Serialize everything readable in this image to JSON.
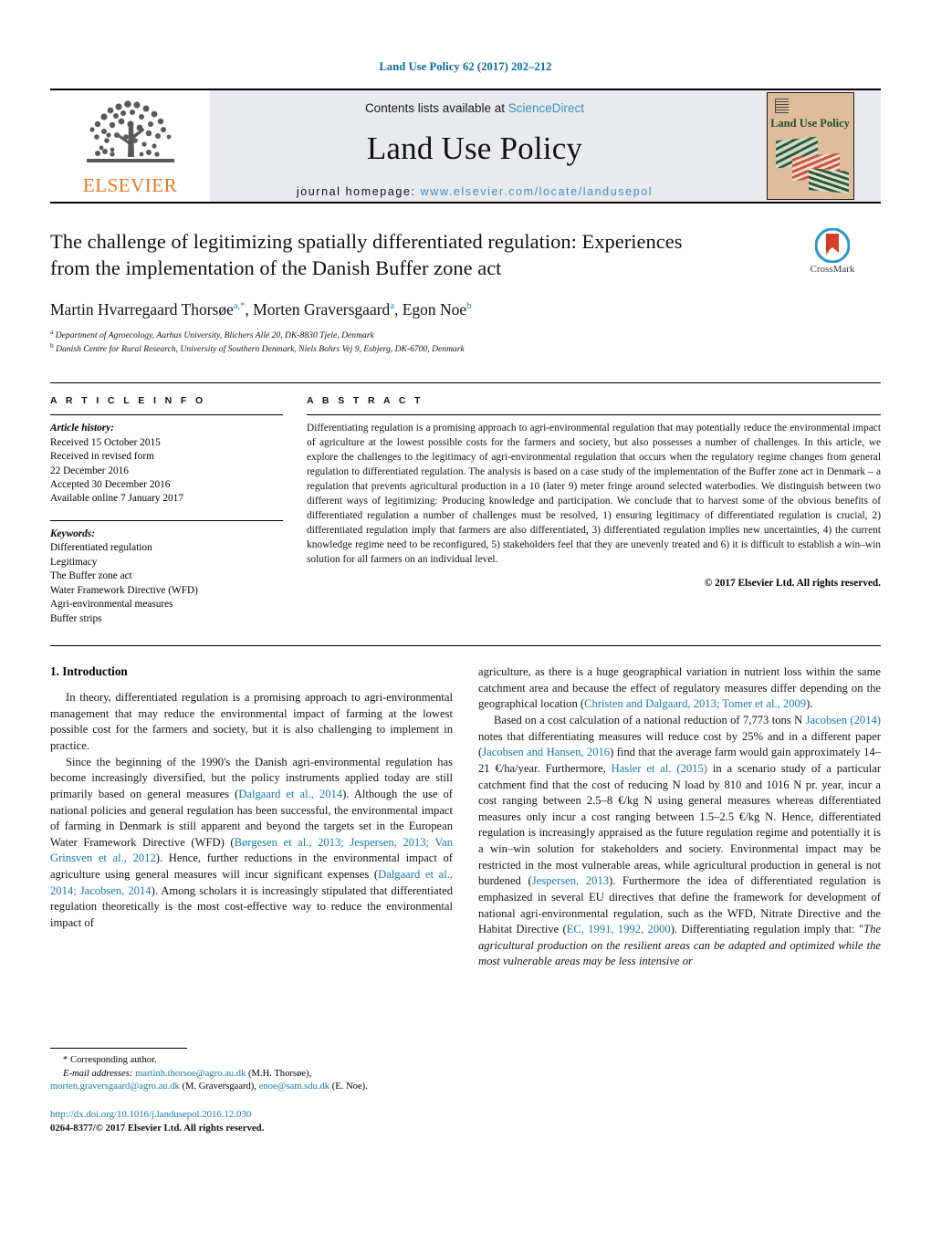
{
  "running_head": "Land Use Policy 62 (2017) 202–212",
  "masthead": {
    "contents_prefix": "Contents lists available at ",
    "sciencedirect": "ScienceDirect",
    "journal_name": "Land Use Policy",
    "homepage_prefix": "journal homepage: ",
    "homepage_url": "www.elsevier.com/locate/landusepol",
    "elsevier_wordmark": "ELSEVIER",
    "elsevier_accent_color": "#e87722",
    "link_color": "#3f8fc4",
    "cover_title": "Land Use Policy"
  },
  "title_block": {
    "title": "The challenge of legitimizing spatially differentiated regulation: Experiences from the implementation of the Danish Buffer zone act",
    "authors": [
      {
        "name": "Martin Hvarregaard Thorsøe",
        "marks": "a,*"
      },
      {
        "name": "Morten Graversgaard",
        "marks": "a"
      },
      {
        "name": "Egon Noe",
        "marks": "b"
      }
    ],
    "affiliations": [
      {
        "mark": "a",
        "text": "Department of Agroecology, Aarhus University, Blichers Allé 20, DK-8830 Tjele, Denmark"
      },
      {
        "mark": "b",
        "text": "Danish Centre for Rural Research, University of Southern Denmark, Niels Bohrs Vej 9, Esbjerg, DK-6700, Denmark"
      }
    ],
    "crossmark_label": "CrossMark"
  },
  "article_info": {
    "label": "A R T I C L E    I N F O",
    "history_head": "Article history:",
    "history_lines": [
      "Received 15 October 2015",
      "Received in revised form",
      "22 December 2016",
      "Accepted 30 December 2016",
      "Available online 7 January 2017"
    ],
    "keywords_head": "Keywords:",
    "keywords": [
      "Differentiated regulation",
      "Legitimacy",
      "The Buffer zone act",
      "Water Framework Directive (WFD)",
      "Agri-environmental measures",
      "Buffer strips"
    ]
  },
  "abstract": {
    "label": "A B S T R A C T",
    "text": "Differentiating regulation is a promising approach to agri-environmental regulation that may potentially reduce the environmental impact of agriculture at the lowest possible costs for the farmers and society, but also possesses a number of challenges. In this article, we explore the challenges to the legitimacy of agri-environmental regulation that occurs when the regulatory regime changes from general regulation to differentiated regulation. The analysis is based on a case study of the implementation of the Buffer zone act in Denmark – a regulation that prevents agricultural production in a 10 (later 9) meter fringe around selected waterbodies. We distinguish between two different ways of legitimizing: Producing knowledge and participation. We conclude that to harvest some of the obvious benefits of differentiated regulation a number of challenges must be resolved, 1) ensuring legitimacy of differentiated regulation is crucial, 2) differentiated regulation imply that farmers are also differentiated, 3) differentiated regulation implies new uncertainties, 4) the current knowledge regime need to be reconfigured, 5) stakeholders feel that they are unevenly treated and 6) it is difficult to establish a win–win solution for all farmers on an individual level.",
    "copyright": "© 2017 Elsevier Ltd. All rights reserved."
  },
  "body": {
    "section_number_title": "1.  Introduction",
    "left_column": {
      "para1_a": "In theory, differentiated regulation is a promising approach to agri-environmental management that may reduce the environmental impact of farming at the lowest possible cost for the farmers and society, but it is also challenging to implement in practice.",
      "para2_a": "Since the beginning of the 1990's the Danish agri-environmental regulation has become increasingly diversified, but the policy instruments applied today are still primarily based on general measures (",
      "cite1": "Dalgaard et al., 2014",
      "para2_b": "). Although the use of national policies and general regulation has been successful, the environmental impact of farming in Denmark is still apparent and beyond the targets set in the European Water Framework Directive (WFD) (",
      "cite2": "Børgesen et al., 2013; Jespersen, 2013; Van Grinsven et al., 2012",
      "para2_c": "). Hence, further reductions in the environmental impact of agriculture using general measures will incur significant expenses (",
      "cite3": "Dalgaard et al., 2014; Jacobsen, 2014",
      "para2_d": "). Among scholars it is increasingly stipulated that differentiated regulation theoretically is the most cost-effective way to reduce the environmental impact of"
    },
    "right_column": {
      "para_cont_a": "agriculture, as there is a huge geographical variation in nutrient loss within the same catchment area and because the effect of regulatory measures differ depending on the geographical location (",
      "cite4": "Christen and Dalgaard, 2013; Tomer et al., 2009",
      "para_cont_b": ").",
      "para3_a": "Based on a cost calculation of a national reduction of 7,773 tons N ",
      "cite5": "Jacobsen (2014)",
      "para3_b": " notes that differentiating measures will reduce cost by 25% and in a different paper (",
      "cite6": "Jacobsen and Hansen, 2016",
      "para3_c": ") find that the average farm would gain approximately 14–21 €/ha/year. Furthermore, ",
      "cite7": "Hasler et al. (2015)",
      "para3_d": " in a scenario study of a particular catchment find that the cost of reducing N load by 810 and 1016 N pr. year, incur a cost ranging between 2.5–8 €/kg N using general measures whereas differentiated measures only incur a cost ranging between 1.5–2.5 €/kg N. Hence, differentiated regulation is increasingly appraised as the future regulation regime and potentially it is a win–win solution for stakeholders and society. Environmental impact may be restricted in the most vulnerable areas, while agricultural production in general is not burdened (",
      "cite8": "Jespersen, 2013",
      "para3_e": "). Furthermore the idea of differentiated regulation is emphasized in several EU directives that define the framework for development of national agri-environmental regulation, such as the WFD, Nitrate Directive and the Habitat Directive (",
      "cite9": "EC, 1991, 1992, 2000",
      "para3_f": "). Differentiating regulation imply that: \"",
      "quote": "The agricultural production on the resilient areas can be adapted and optimized while the most vulnerable areas may be less intensive or"
    }
  },
  "footnotes": {
    "corresponding": "* Corresponding author.",
    "email_label": "E-mail addresses:",
    "email1": "martinh.thorsoe@agro.au.dk",
    "email1_owner": " (M.H. Thorsøe),",
    "email2": "morten.graversgaard@agro.au.dk",
    "email2_owner": " (M. Graversgaard), ",
    "email3": "enoe@sam.sdu.dk",
    "email3_owner": " (E. Noe).",
    "doi": "http://dx.doi.org/10.1016/j.landusepol.2016.12.030",
    "issn_line": "0264-8377/© 2017 Elsevier Ltd. All rights reserved."
  }
}
